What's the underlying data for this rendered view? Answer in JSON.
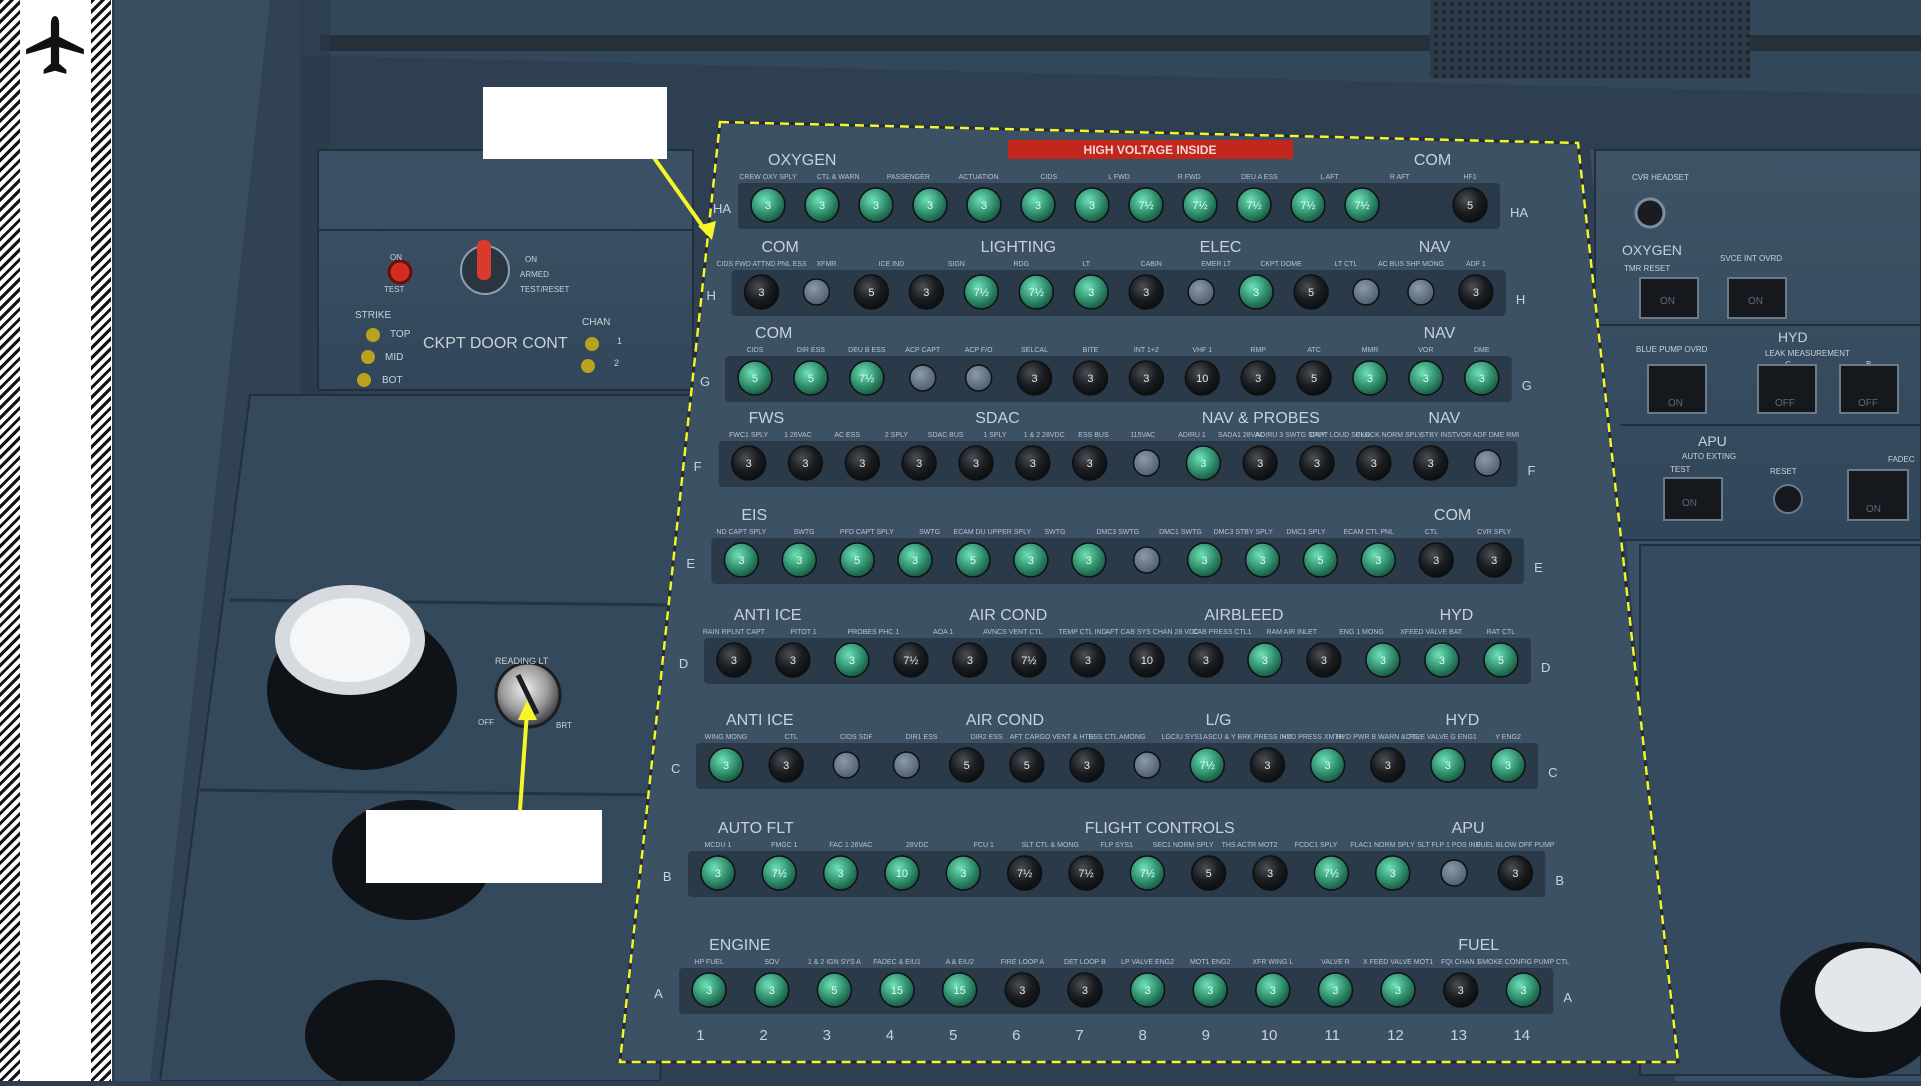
{
  "warning_label": "HIGH VOLTAGE INSIDE",
  "left_panel": {
    "test_labels": [
      "ON",
      "TEST"
    ],
    "switch_labels": [
      "ON",
      "ARMED",
      "TEST/RESET"
    ],
    "strike_label": "STRIKE",
    "chan_label": "CHAN",
    "strike_positions": [
      "TOP",
      "MID",
      "BOT"
    ],
    "chan_numbers": [
      "1",
      "2"
    ],
    "door_label": "CKPT DOOR CONT",
    "reading_light_label": "READING LT",
    "knob_labels": [
      "OFF",
      "BRT"
    ]
  },
  "right_panel": {
    "cvr_label": "CVR HEADSET",
    "oxygen_label": "OXYGEN",
    "oxygen_buttons": [
      "TMR RESET",
      "SVCE INT OVRD"
    ],
    "hyd_label": "HYD",
    "blue_pump": "BLUE PUMP OVRD",
    "leak_measurement": "LEAK MEASUREMENT",
    "leak_letters": [
      "G",
      "B"
    ],
    "apu_label": "APU",
    "auto_exting": "AUTO EXTING",
    "apu_buttons": [
      "TEST",
      "RESET"
    ],
    "fadec_label": "FADEC",
    "on_label": "ON",
    "off_label": "OFF"
  },
  "breaker_panel": {
    "row_letters": [
      "HA",
      "H",
      "G",
      "F",
      "E",
      "D",
      "C",
      "B",
      "A"
    ],
    "column_numbers": [
      "1",
      "2",
      "3",
      "4",
      "5",
      "6",
      "7",
      "8",
      "9",
      "10",
      "11",
      "12",
      "13",
      "14"
    ],
    "group_titles": {
      "HA": [
        "OXYGEN",
        "COM"
      ],
      "H": [
        "COM",
        "LIGHTING",
        "ELEC",
        "NAV"
      ],
      "G": [
        "COM",
        "NAV"
      ],
      "F": [
        "FWS",
        "SDAC",
        "NAV & PROBES",
        "NAV"
      ],
      "E": [
        "EIS",
        "COM"
      ],
      "D": [
        "ANTI ICE",
        "AIR COND",
        "AIRBLEED",
        "HYD"
      ],
      "C": [
        "ANTI ICE",
        "AIR COND",
        "L/G",
        "HYD"
      ],
      "B": [
        "AUTO FLT",
        "FLIGHT CONTROLS",
        "APU"
      ],
      "A": [
        "ENGINE",
        "FUEL"
      ]
    },
    "sub_labels": {
      "HA": [
        "CREW OXY SPLY",
        "CTL & WARN",
        "PASSENGER",
        "ACTUATION",
        "CIDS",
        "L FWD",
        "R FWD",
        "DEU A ESS",
        "L AFT",
        "R AFT",
        "HF1"
      ],
      "H": [
        "CIDS FWD ATTND PNL ESS",
        "XFMR",
        "ICE IND",
        "SIGN",
        "RDG",
        "LT",
        "CABIN",
        "EMER LT",
        "CKPT DOME",
        "LT CTL",
        "AC BUS SHP MONG",
        "ADF 1"
      ],
      "G": [
        "CIDS",
        "DIR ESS",
        "DEU B ESS",
        "ACP CAPT",
        "ACP F/O",
        "SELCAL",
        "BITE",
        "INT 1+2",
        "VHF 1",
        "RMP",
        "ATC",
        "MMR",
        "VOR",
        "DME"
      ],
      "F": [
        "FWC1 SPLY",
        "1 26VAC",
        "AC ESS",
        "2 SPLY",
        "SDAC BUS",
        "1 SPLY",
        "1 & 2 28VDC",
        "ESS BUS",
        "115VAC",
        "ADIRU 1",
        "SADA1 28VAC",
        "ADIRU 3 SWTG SPLY",
        "CAPT LOUD SPKR",
        "CLOCK NORM SPLY",
        "STBY INST",
        "VOR ADF DME RMI"
      ],
      "E": [
        "ND CAPT SPLY",
        "SWTG",
        "PFD CAPT SPLY",
        "SWTG",
        "ECAM DU UPPER SPLY",
        "SWTG",
        "DMC3 SWTG",
        "DMC1 SWTG",
        "DMC3 STBY SPLY",
        "DMC1 SPLY",
        "ECAM CTL PNL",
        "CTL",
        "CVR SPLY"
      ],
      "D": [
        "RAIN RPLNT CAPT",
        "PITOT 1",
        "PROBES PHC 1",
        "AOA 1",
        "AVNCS VENT CTL",
        "TEMP CTL IND",
        "AFT CAB SYS CHAN 28 VDC",
        "CAB PRESS CTL1",
        "RAM AIR INLET",
        "ENG 1 MONG",
        "XFEED VALVE BAT",
        "RAT CTL"
      ],
      "C": [
        "WING MONG",
        "CTL",
        "CIDS SDF",
        "DIR1 ESS",
        "DIR2 ESS",
        "AFT CARGO VENT & HTG",
        "ESS CTL AMONG",
        "LGCIU SYS1",
        "ASCU & Y BRK PRESS IND",
        "HYD PRESS XMTR",
        "HYD PWR B WARN &CTL",
        "FIRE VALVE G ENG1",
        "Y ENG2"
      ],
      "B": [
        "MCDU 1",
        "FMGC 1",
        "FAC 1 26VAC",
        "28VDC",
        "FCU 1",
        "SLT CTL & MONG",
        "FLP SYS1",
        "SEC1 NORM SPLY",
        "THS ACTR MOT2",
        "FCDC1 SPLY",
        "FLAC1 NORM SPLY",
        "SLT FLP 1 POS IND",
        "FUEL BLOW OFF PUMP"
      ],
      "A": [
        "HP FUEL",
        "SOV",
        "1 & 2 IGN SYS A",
        "FADEC & EIU1",
        "A & EIU2",
        "FIRE LOOP A",
        "DET LOOP B",
        "LP VALVE ENG2",
        "MOT1 ENG2",
        "XFR WING L",
        "VALVE R",
        "X FEED VALVE MOT1",
        "FQI CHAN 1",
        "SMOKE CONFIG PUMP CTL"
      ]
    },
    "rows": {
      "HA": [
        [
          "3",
          "g"
        ],
        [
          "3",
          "g"
        ],
        [
          "3",
          "g"
        ],
        [
          "3",
          "g"
        ],
        [
          "3",
          "g"
        ],
        [
          "3",
          "g"
        ],
        [
          "3",
          "g"
        ],
        [
          "7½",
          "g"
        ],
        [
          "7½",
          "g"
        ],
        [
          "7½",
          "g"
        ],
        [
          "7½",
          "g"
        ],
        [
          "7½",
          "g"
        ],
        [
          "",
          ""
        ],
        [
          "5",
          "b"
        ]
      ],
      "H": [
        [
          "3",
          "b"
        ],
        [
          "",
          "e"
        ],
        [
          "5",
          "b"
        ],
        [
          "3",
          "b"
        ],
        [
          "7½",
          "g"
        ],
        [
          "7½",
          "g"
        ],
        [
          "3",
          "g"
        ],
        [
          "3",
          "b"
        ],
        [
          "",
          "e"
        ],
        [
          "3",
          "g"
        ],
        [
          "5",
          "b"
        ],
        [
          "",
          "e"
        ],
        [
          "",
          "e"
        ],
        [
          "3",
          "b"
        ]
      ],
      "G": [
        [
          "5",
          "g"
        ],
        [
          "5",
          "g"
        ],
        [
          "7½",
          "g"
        ],
        [
          "",
          "e"
        ],
        [
          "",
          "e"
        ],
        [
          "3",
          "b"
        ],
        [
          "3",
          "b"
        ],
        [
          "3",
          "b"
        ],
        [
          "10",
          "b"
        ],
        [
          "3",
          "b"
        ],
        [
          "5",
          "b"
        ],
        [
          "3",
          "g"
        ],
        [
          "3",
          "g"
        ],
        [
          "3",
          "g"
        ]
      ],
      "F": [
        [
          "3",
          "b"
        ],
        [
          "3",
          "b"
        ],
        [
          "3",
          "b"
        ],
        [
          "3",
          "b"
        ],
        [
          "3",
          "b"
        ],
        [
          "3",
          "b"
        ],
        [
          "3",
          "b"
        ],
        [
          "",
          "e"
        ],
        [
          "3",
          "g"
        ],
        [
          "3",
          "b"
        ],
        [
          "3",
          "b"
        ],
        [
          "3",
          "b"
        ],
        [
          "3",
          "b"
        ],
        [
          "",
          "e"
        ]
      ],
      "E": [
        [
          "3",
          "g"
        ],
        [
          "3",
          "g"
        ],
        [
          "5",
          "g"
        ],
        [
          "3",
          "g"
        ],
        [
          "5",
          "g"
        ],
        [
          "3",
          "g"
        ],
        [
          "3",
          "g"
        ],
        [
          "",
          "e"
        ],
        [
          "3",
          "g"
        ],
        [
          "3",
          "g"
        ],
        [
          "5",
          "g"
        ],
        [
          "3",
          "g"
        ],
        [
          "3",
          "b"
        ],
        [
          "3",
          "b"
        ]
      ],
      "D": [
        [
          "3",
          "b"
        ],
        [
          "3",
          "b"
        ],
        [
          "3",
          "g"
        ],
        [
          "7½",
          "b"
        ],
        [
          "3",
          "b"
        ],
        [
          "7½",
          "b"
        ],
        [
          "3",
          "b"
        ],
        [
          "10",
          "b"
        ],
        [
          "3",
          "b"
        ],
        [
          "3",
          "g"
        ],
        [
          "3",
          "b"
        ],
        [
          "3",
          "g"
        ],
        [
          "3",
          "g"
        ],
        [
          "5",
          "g"
        ]
      ],
      "C": [
        [
          "3",
          "g"
        ],
        [
          "3",
          "b"
        ],
        [
          "",
          "e"
        ],
        [
          "",
          "e"
        ],
        [
          "5",
          "b"
        ],
        [
          "5",
          "b"
        ],
        [
          "3",
          "b"
        ],
        [
          "",
          "e"
        ],
        [
          "7½",
          "g"
        ],
        [
          "3",
          "b"
        ],
        [
          "3",
          "g"
        ],
        [
          "3",
          "b"
        ],
        [
          "3",
          "g"
        ],
        [
          "3",
          "g"
        ]
      ],
      "B": [
        [
          "3",
          "g"
        ],
        [
          "7½",
          "g"
        ],
        [
          "3",
          "g"
        ],
        [
          "10",
          "g"
        ],
        [
          "3",
          "g"
        ],
        [
          "7½",
          "b"
        ],
        [
          "7½",
          "b"
        ],
        [
          "7½",
          "g"
        ],
        [
          "5",
          "b"
        ],
        [
          "3",
          "b"
        ],
        [
          "7½",
          "g"
        ],
        [
          "3",
          "g"
        ],
        [
          "",
          "e"
        ],
        [
          "3",
          "b"
        ]
      ],
      "A": [
        [
          "3",
          "g"
        ],
        [
          "3",
          "g"
        ],
        [
          "5",
          "g"
        ],
        [
          "15",
          "g"
        ],
        [
          "15",
          "g"
        ],
        [
          "3",
          "b"
        ],
        [
          "3",
          "b"
        ],
        [
          "3",
          "g"
        ],
        [
          "3",
          "g"
        ],
        [
          "3",
          "g"
        ],
        [
          "3",
          "g"
        ],
        [
          "3",
          "g"
        ],
        [
          "3",
          "b"
        ],
        [
          "3",
          "g"
        ]
      ]
    }
  },
  "colors": {
    "background": "#2c3e50",
    "panel": "#36485a",
    "breaker_green": "#2e8c6a",
    "breaker_black": "#1a1c1f",
    "highlight_frame": "#f5f52a",
    "warning_red": "#c1271c"
  },
  "icons": [
    "airplane-icon",
    "guarded-switch-icon",
    "reading-light-knob-icon",
    "speaker-icon"
  ]
}
